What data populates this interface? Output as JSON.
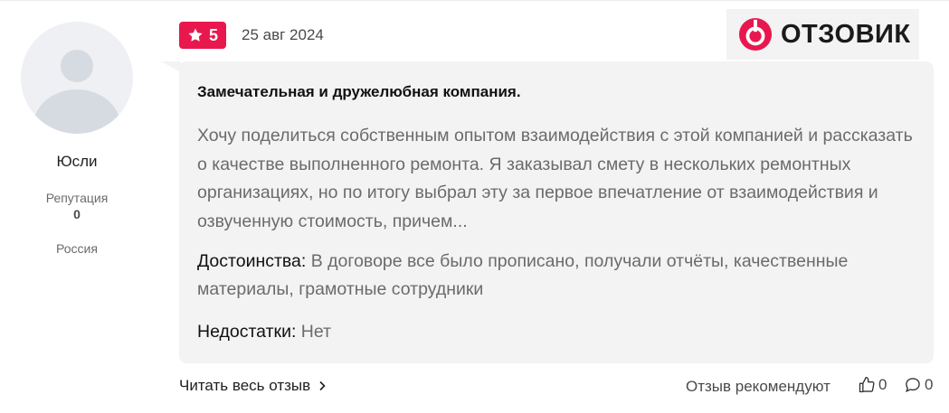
{
  "user": {
    "name": "Юсли",
    "reputation_label": "Репутация",
    "reputation_value": "0",
    "country": "Россия"
  },
  "review": {
    "rating": "5",
    "date": "25 авг 2024",
    "title": "Замечательная и дружелюбная компания.",
    "text": "Хочу поделиться собственным опытом взаимодействия с этой компанией и рассказать о качестве выполненного ремонта. Я заказывал смету в нескольких ремонтных организациях, но по итогу выбрал эту за первое впечатление от взаимодействия и озвученную стоимость, причем...",
    "pros_label": "Достоинства:",
    "pros_text": "В договоре все было прописано, получали отчёты, качественные материалы, грамотные сотрудники",
    "cons_label": "Недостатки:",
    "cons_text": "Нет"
  },
  "brand": {
    "name": "ОТЗОВИК",
    "accent": "#e8184f"
  },
  "footer": {
    "read_more": "Читать весь отзыв",
    "recommend_label": "Отзыв рекомендуют",
    "likes_count": "0",
    "comments_count": "0"
  },
  "icons": [
    "avatar-placeholder",
    "star-icon",
    "otzovik-logo-icon",
    "chevron-right-icon",
    "thumbs-up-icon",
    "comment-icon"
  ]
}
